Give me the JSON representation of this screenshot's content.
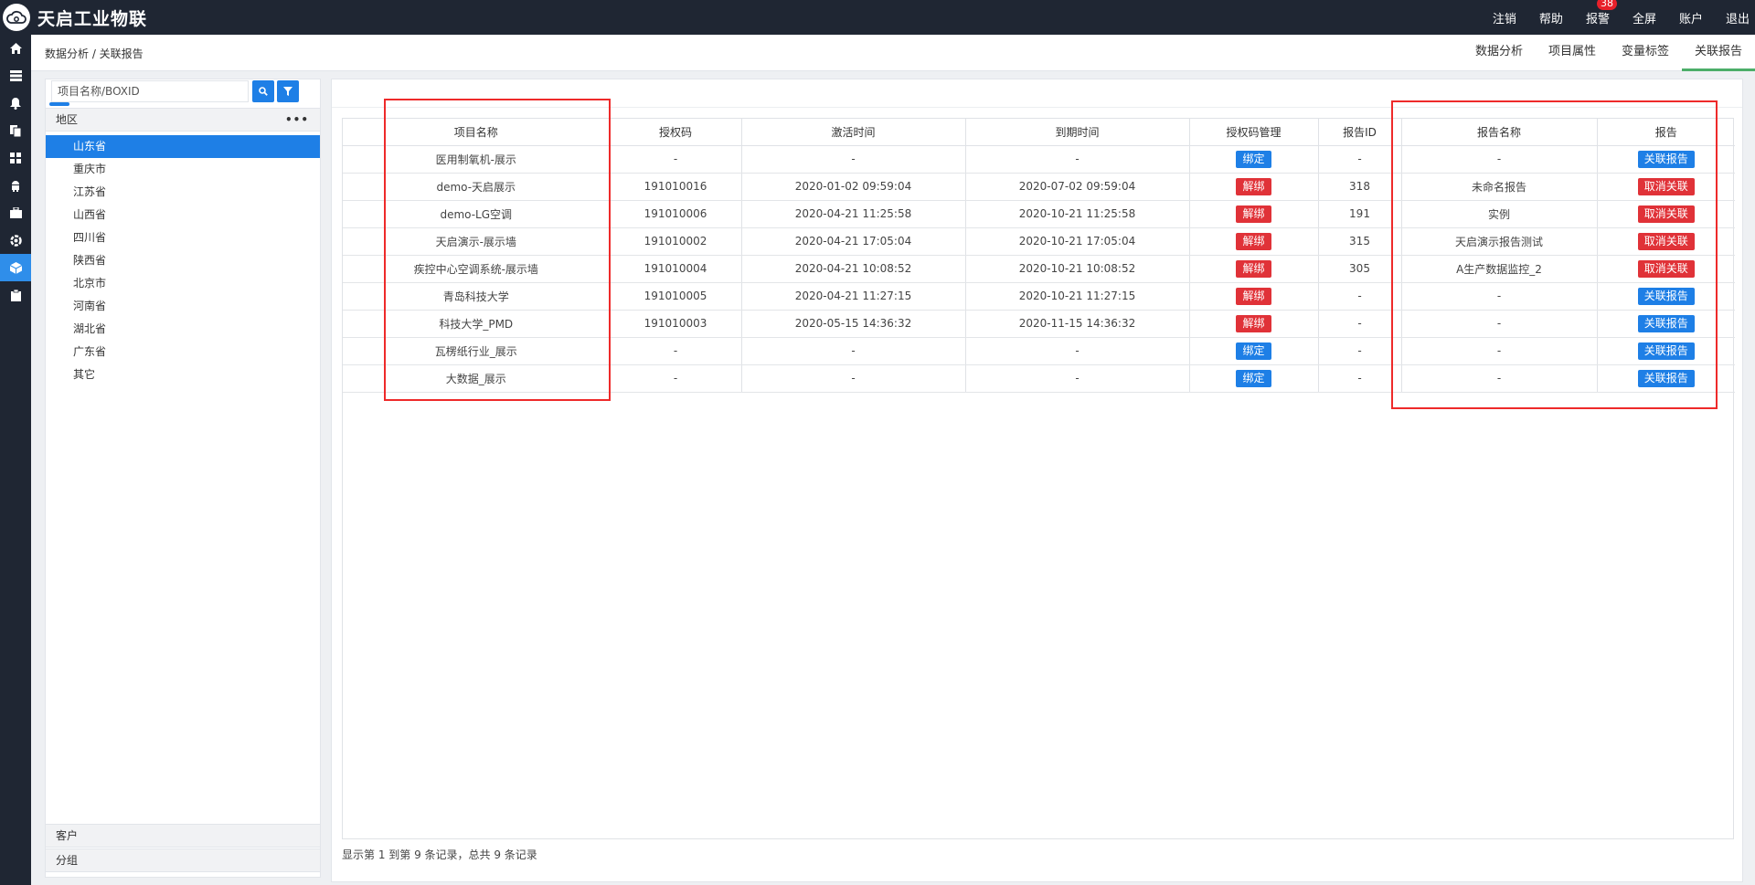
{
  "app": {
    "brand": "天启工业物联"
  },
  "topnav": {
    "items": [
      "注销",
      "帮助",
      "报警",
      "全屏",
      "账户",
      "退出"
    ],
    "alarm_badge": "38"
  },
  "breadcrumb": "数据分析 / 关联报告",
  "tabs": [
    "数据分析",
    "项目属性",
    "变量标签",
    "关联报告"
  ],
  "active_tab": "关联报告",
  "left_panel": {
    "search_placeholder": "项目名称/BOXID",
    "region_header": "地区",
    "more_label": "•••",
    "regions": [
      "山东省",
      "重庆市",
      "江苏省",
      "山西省",
      "四川省",
      "陕西省",
      "北京市",
      "河南省",
      "湖北省",
      "广东省",
      "其它"
    ],
    "selected_region": "山东省",
    "customer_header": "客户",
    "group_header": "分组"
  },
  "table": {
    "columns": [
      "项目名称",
      "授权码",
      "激活时间",
      "到期时间",
      "授权码管理",
      "报告ID",
      "报告名称",
      "报告"
    ],
    "rows": [
      {
        "name": "医用制氧机-展示",
        "code": "-",
        "activated": "-",
        "expires": "-",
        "manage": "绑定",
        "manage_color": "blue",
        "report_id": "-",
        "report_name": "-",
        "report_action": "关联报告",
        "report_color": "blue"
      },
      {
        "name": "demo-天启展示",
        "code": "191010016",
        "activated": "2020-01-02 09:59:04",
        "expires": "2020-07-02 09:59:04",
        "manage": "解绑",
        "manage_color": "red",
        "report_id": "318",
        "report_name": "未命名报告",
        "report_action": "取消关联",
        "report_color": "red"
      },
      {
        "name": "demo-LG空调",
        "code": "191010006",
        "activated": "2020-04-21 11:25:58",
        "expires": "2020-10-21 11:25:58",
        "manage": "解绑",
        "manage_color": "red",
        "report_id": "191",
        "report_name": "实例",
        "report_action": "取消关联",
        "report_color": "red"
      },
      {
        "name": "天启演示-展示墙",
        "code": "191010002",
        "activated": "2020-04-21 17:05:04",
        "expires": "2020-10-21 17:05:04",
        "manage": "解绑",
        "manage_color": "red",
        "report_id": "315",
        "report_name": "天启演示报告测试",
        "report_action": "取消关联",
        "report_color": "red"
      },
      {
        "name": "疾控中心空调系统-展示墙",
        "code": "191010004",
        "activated": "2020-04-21 10:08:52",
        "expires": "2020-10-21 10:08:52",
        "manage": "解绑",
        "manage_color": "red",
        "report_id": "305",
        "report_name": "A生产数据监控_2",
        "report_action": "取消关联",
        "report_color": "red"
      },
      {
        "name": "青岛科技大学",
        "code": "191010005",
        "activated": "2020-04-21 11:27:15",
        "expires": "2020-10-21 11:27:15",
        "manage": "解绑",
        "manage_color": "red",
        "report_id": "-",
        "report_name": "-",
        "report_action": "关联报告",
        "report_color": "blue"
      },
      {
        "name": "科技大学_PMD",
        "code": "191010003",
        "activated": "2020-05-15 14:36:32",
        "expires": "2020-11-15 14:36:32",
        "manage": "解绑",
        "manage_color": "red",
        "report_id": "-",
        "report_name": "-",
        "report_action": "关联报告",
        "report_color": "blue"
      },
      {
        "name": "瓦楞纸行业_展示",
        "code": "-",
        "activated": "-",
        "expires": "-",
        "manage": "绑定",
        "manage_color": "blue",
        "report_id": "-",
        "report_name": "-",
        "report_action": "关联报告",
        "report_color": "blue"
      },
      {
        "name": "大数据_展示",
        "code": "-",
        "activated": "-",
        "expires": "-",
        "manage": "绑定",
        "manage_color": "blue",
        "report_id": "-",
        "report_name": "-",
        "report_action": "关联报告",
        "report_color": "blue"
      }
    ]
  },
  "footer": "显示第 1 到第 9 条记录，总共 9 条记录",
  "rail_icons": [
    "home-icon",
    "database-icon",
    "bell-icon",
    "copy-icon",
    "grid-icon",
    "android-icon",
    "briefcase-icon",
    "shield-icon",
    "cube-icon",
    "clipboard-icon"
  ],
  "colors": {
    "accent": "#1e7fe6",
    "danger": "#e03238",
    "dark": "#1f2633",
    "tab_active": "#4cae69",
    "annotation": "#ee2a2a"
  }
}
